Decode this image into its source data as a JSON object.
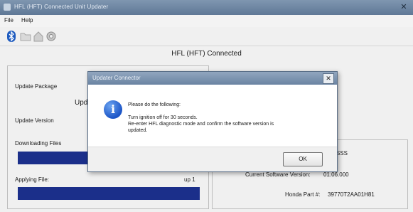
{
  "window": {
    "title": "HFL (HFT) Connected Unit Updater"
  },
  "menu": {
    "file": "File",
    "help": "Help"
  },
  "toolbar": {
    "icons": [
      "bluetooth-icon",
      "folder-icon",
      "home-icon",
      "settings-icon"
    ]
  },
  "status": {
    "text": "HFL (HFT) Connected"
  },
  "left_panel": {
    "update_package_label": "Update Package",
    "upd_partial": "Upd",
    "update_version_label": "Update Version",
    "downloading_files_label": "Downloading Files",
    "applying_file_label": "Applying File:",
    "applying_value": "up 1"
  },
  "right_panel": {
    "sss_partial": "SSS",
    "version_label": "Current Software Version:",
    "version_value": "01.06.000",
    "part_label": "Honda Part #:",
    "part_value": "39770T2AA01H81"
  },
  "dialog": {
    "title": "Updater Connector",
    "heading": "Please do the following:",
    "line1": "Turn ignition off for 30 seconds.",
    "line2": "Re-enter HFL diagnostic mode and confirm the software version is",
    "line3": "updated.",
    "ok_label": "OK"
  },
  "colors": {
    "progress": "#1b2f8a",
    "titlebar": "#6a83a2",
    "info_icon": "#1c55c7"
  }
}
